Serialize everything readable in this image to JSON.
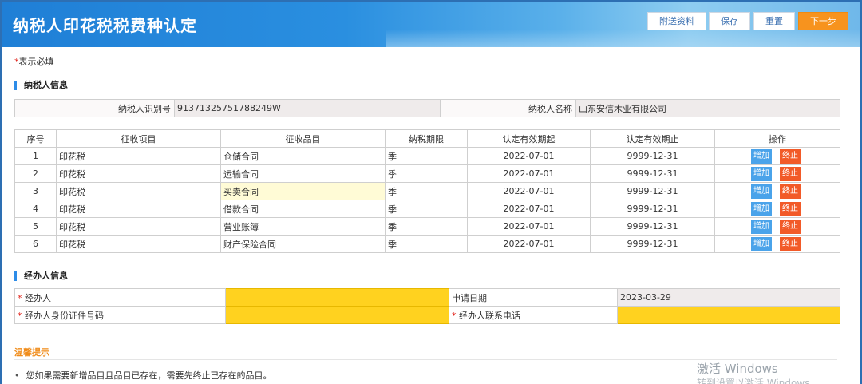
{
  "header": {
    "title": "纳税人印花税税费种认定",
    "buttons": {
      "attach": "附送资料",
      "save": "保存",
      "reset": "重置",
      "next": "下一步"
    }
  },
  "required_note": {
    "star": "*",
    "text": "表示必填"
  },
  "taxpayer": {
    "section_title": "纳税人信息",
    "id_label": "纳税人识别号",
    "id_value": "91371325751788249W",
    "name_label": "纳税人名称",
    "name_value": "山东安信木业有限公司"
  },
  "items_table": {
    "headers": [
      "序号",
      "征收项目",
      "征收品目",
      "纳税期限",
      "认定有效期起",
      "认定有效期止",
      "操作"
    ],
    "add_label": "增加",
    "stop_label": "终止",
    "rows": [
      {
        "no": "1",
        "project": "印花税",
        "item": "仓储合同",
        "period": "季",
        "start": "2022-07-01",
        "end": "9999-12-31"
      },
      {
        "no": "2",
        "project": "印花税",
        "item": "运输合同",
        "period": "季",
        "start": "2022-07-01",
        "end": "9999-12-31"
      },
      {
        "no": "3",
        "project": "印花税",
        "item": "买卖合同",
        "period": "季",
        "start": "2022-07-01",
        "end": "9999-12-31"
      },
      {
        "no": "4",
        "project": "印花税",
        "item": "借款合同",
        "period": "季",
        "start": "2022-07-01",
        "end": "9999-12-31"
      },
      {
        "no": "5",
        "project": "印花税",
        "item": "营业账簿",
        "period": "季",
        "start": "2022-07-01",
        "end": "9999-12-31"
      },
      {
        "no": "6",
        "project": "印花税",
        "item": "财产保险合同",
        "period": "季",
        "start": "2022-07-01",
        "end": "9999-12-31"
      }
    ]
  },
  "agent": {
    "section_title": "经办人信息",
    "star": "*",
    "agent_label": "经办人",
    "agent_value": "",
    "date_label": "申请日期",
    "date_value": "2023-03-29",
    "id_label": "经办人身份证件号码",
    "id_value": "",
    "phone_label": "经办人联系电话",
    "phone_value": ""
  },
  "tips": {
    "title": "温馨提示",
    "text": "您如果需要新增品目且品目已存在，需要先终止已存在的品目。"
  },
  "watermark": {
    "line1": "激活 Windows",
    "line2": "转到设置以激活 Windows"
  },
  "colors": {
    "accent": "#2d8ce8",
    "next_button": "#f7931e",
    "add_button": "#4aa3ea",
    "stop_button": "#f25a28",
    "required_field": "#ffd21f"
  }
}
